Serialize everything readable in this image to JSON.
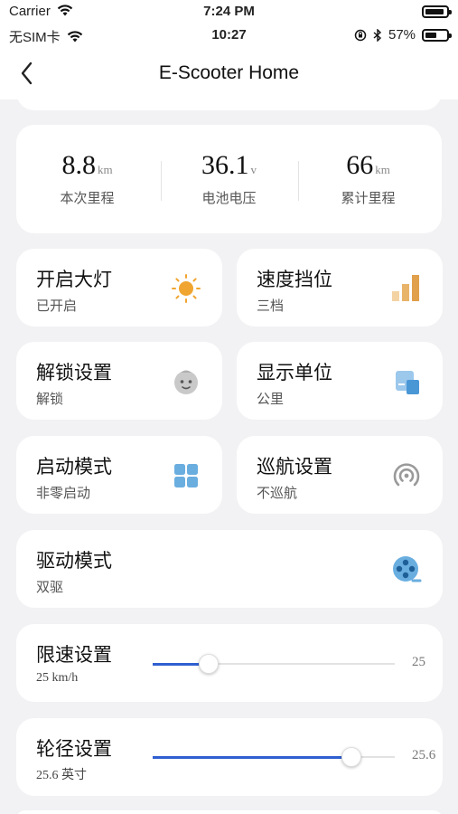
{
  "system_status": {
    "carrier": "Carrier",
    "time": "7:24 PM"
  },
  "app_status": {
    "sim": "无SIM卡",
    "time": "10:27",
    "battery_pct": "57%"
  },
  "nav": {
    "title": "E-Scooter Home"
  },
  "stats": [
    {
      "value": "8.8",
      "unit": "km",
      "label": "本次里程"
    },
    {
      "value": "36.1",
      "unit": "v",
      "label": "电池电压"
    },
    {
      "value": "66",
      "unit": "km",
      "label": "累计里程"
    }
  ],
  "tiles": {
    "headlight": {
      "title": "开启大灯",
      "status": "已开启",
      "icon": "sun-icon"
    },
    "speed_gear": {
      "title": "速度挡位",
      "status": "三档",
      "icon": "signal-bars-icon"
    },
    "unlock": {
      "title": "解锁设置",
      "status": "解锁",
      "icon": "baby-face-icon"
    },
    "display_unit": {
      "title": "显示单位",
      "status": "公里",
      "icon": "display-unit-icon"
    },
    "start_mode": {
      "title": "启动模式",
      "status": "非零启动",
      "icon": "grid-icon"
    },
    "cruise": {
      "title": "巡航设置",
      "status": "不巡航",
      "icon": "cruise-icon"
    },
    "drive_mode": {
      "title": "驱动模式",
      "status": "双驱",
      "icon": "film-reel-icon"
    }
  },
  "sliders": {
    "speed_limit": {
      "title": "限速设置",
      "value_label": "25 km/h",
      "max_label": "25",
      "level": 0.23
    },
    "wheel_size": {
      "title": "轮径设置",
      "value_label": "25.6 英寸",
      "max_label": "25.6",
      "level": 0.82
    }
  },
  "colors": {
    "accent": "#2f5fd0",
    "sun": "#f0a531",
    "bars": "#e8b46a",
    "icon_blue": "#6aaee0",
    "icon_gray": "#9a9a9a"
  }
}
